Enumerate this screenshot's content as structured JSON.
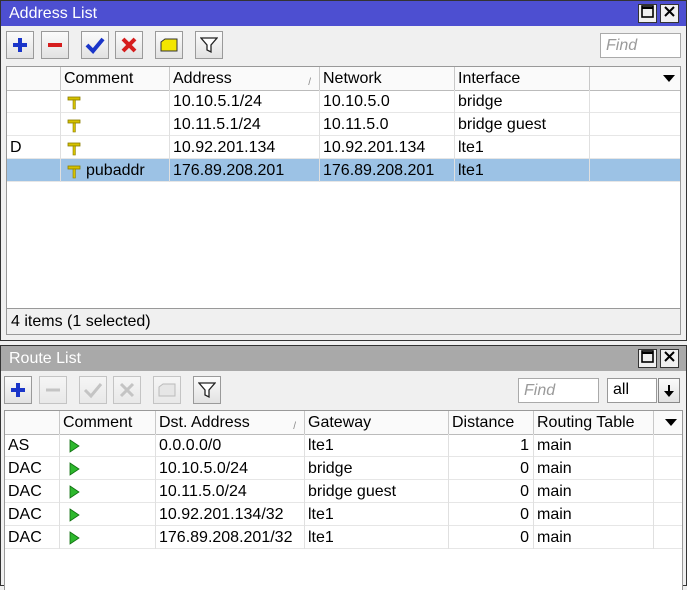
{
  "address_window": {
    "title": "Address List",
    "find_placeholder": "Find",
    "columns": [
      "Comment",
      "Address",
      "Network",
      "Interface"
    ],
    "rows": [
      {
        "flag": "",
        "comment": "",
        "address": "10.10.5.1/24",
        "network": "10.10.5.0",
        "interface": "bridge",
        "selected": false
      },
      {
        "flag": "",
        "comment": "",
        "address": "10.11.5.1/24",
        "network": "10.11.5.0",
        "interface": "bridge guest",
        "selected": false
      },
      {
        "flag": "D",
        "comment": "",
        "address": "10.92.201.134",
        "network": "10.92.201.134",
        "interface": "lte1",
        "selected": false
      },
      {
        "flag": "",
        "comment": "pubaddr",
        "address": "176.89.208.201",
        "network": "176.89.208.201",
        "interface": "lte1",
        "selected": true
      }
    ],
    "status": "4 items (1 selected)"
  },
  "route_window": {
    "title": "Route List",
    "find_placeholder": "Find",
    "filter_value": "all",
    "columns": [
      "Comment",
      "Dst. Address",
      "Gateway",
      "Distance",
      "Routing Table"
    ],
    "rows": [
      {
        "flag": "AS",
        "comment": "",
        "dst": "0.0.0.0/0",
        "gateway": "lte1",
        "distance": "1",
        "table": "main"
      },
      {
        "flag": "DAC",
        "comment": "",
        "dst": "10.10.5.0/24",
        "gateway": "bridge",
        "distance": "0",
        "table": "main"
      },
      {
        "flag": "DAC",
        "comment": "",
        "dst": "10.11.5.0/24",
        "gateway": "bridge guest",
        "distance": "0",
        "table": "main"
      },
      {
        "flag": "DAC",
        "comment": "",
        "dst": "10.92.201.134/32",
        "gateway": "lte1",
        "distance": "0",
        "table": "main"
      },
      {
        "flag": "DAC",
        "comment": "",
        "dst": "176.89.208.201/32",
        "gateway": "lte1",
        "distance": "0",
        "table": "main"
      }
    ]
  },
  "colors": {
    "active_title": "#4d4fd1",
    "inactive_title": "#a9a9a9",
    "selected_row": "#9cc2e5"
  },
  "icons": [
    "add-icon",
    "remove-icon",
    "enable-icon",
    "disable-icon",
    "comment-icon",
    "filter-icon",
    "pin-icon",
    "route-arrow-icon",
    "maximize-icon",
    "close-icon",
    "dropdown-arrow-icon"
  ]
}
